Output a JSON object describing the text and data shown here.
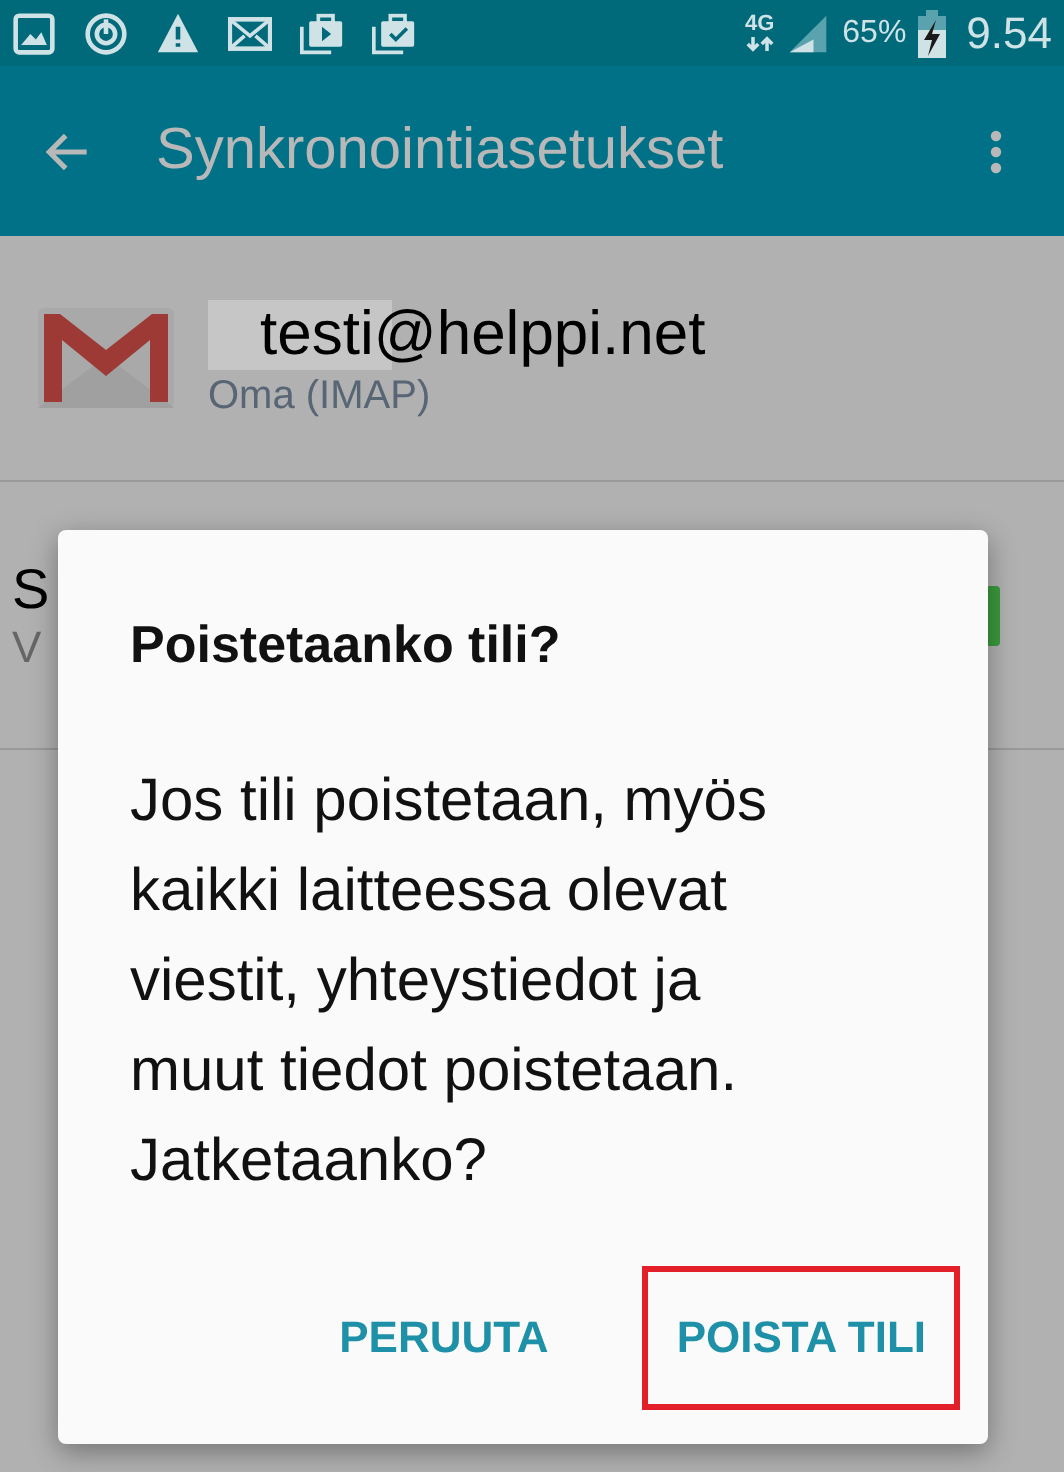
{
  "status_bar": {
    "network": "4G",
    "battery": "65%",
    "time": "9.54"
  },
  "app_bar": {
    "title": "Synkronointiasetukset"
  },
  "account": {
    "email": "testi@helppi.net",
    "type": "Oma (IMAP)"
  },
  "setting_row": {
    "title": "S",
    "subtitle": "V",
    "on": true
  },
  "dialog": {
    "title": "Poistetaanko tili?",
    "message": "Jos tili poistetaan, myös kaikki laitteessa olevat viestit, yhteystiedot ja muut tiedot poistetaan. Jatketaanko?",
    "buttons": [
      {
        "label": "PERUUTA",
        "highlighted": false
      },
      {
        "label": "POISTA TILI",
        "highlighted": true
      }
    ]
  }
}
